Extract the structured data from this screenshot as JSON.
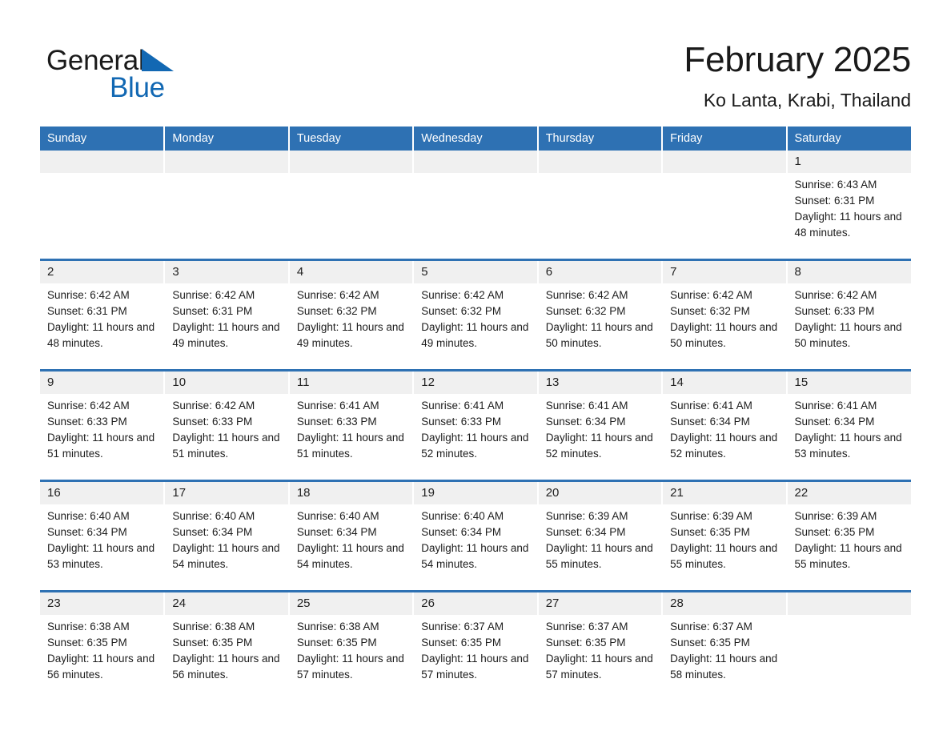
{
  "brand": {
    "name_part1": "General",
    "name_part2": "Blue",
    "triangle_color": "#1268b3"
  },
  "header": {
    "month_title": "February 2025",
    "location": "Ko Lanta, Krabi, Thailand"
  },
  "theme": {
    "header_blue": "#2e71b3",
    "daynum_band": "#f0f0f0",
    "text": "#1d1d1d"
  },
  "weekdays": [
    "Sunday",
    "Monday",
    "Tuesday",
    "Wednesday",
    "Thursday",
    "Friday",
    "Saturday"
  ],
  "labels": {
    "sunrise_prefix": "Sunrise:",
    "sunset_prefix": "Sunset:",
    "daylight_prefix": "Daylight:"
  },
  "weeks": [
    [
      {
        "day": "",
        "empty": true
      },
      {
        "day": "",
        "empty": true
      },
      {
        "day": "",
        "empty": true
      },
      {
        "day": "",
        "empty": true
      },
      {
        "day": "",
        "empty": true
      },
      {
        "day": "",
        "empty": true
      },
      {
        "day": "1",
        "sunrise": "Sunrise: 6:43 AM",
        "sunset": "Sunset: 6:31 PM",
        "daylight": "Daylight: 11 hours and 48 minutes."
      }
    ],
    [
      {
        "day": "2",
        "sunrise": "Sunrise: 6:42 AM",
        "sunset": "Sunset: 6:31 PM",
        "daylight": "Daylight: 11 hours and 48 minutes."
      },
      {
        "day": "3",
        "sunrise": "Sunrise: 6:42 AM",
        "sunset": "Sunset: 6:31 PM",
        "daylight": "Daylight: 11 hours and 49 minutes."
      },
      {
        "day": "4",
        "sunrise": "Sunrise: 6:42 AM",
        "sunset": "Sunset: 6:32 PM",
        "daylight": "Daylight: 11 hours and 49 minutes."
      },
      {
        "day": "5",
        "sunrise": "Sunrise: 6:42 AM",
        "sunset": "Sunset: 6:32 PM",
        "daylight": "Daylight: 11 hours and 49 minutes."
      },
      {
        "day": "6",
        "sunrise": "Sunrise: 6:42 AM",
        "sunset": "Sunset: 6:32 PM",
        "daylight": "Daylight: 11 hours and 50 minutes."
      },
      {
        "day": "7",
        "sunrise": "Sunrise: 6:42 AM",
        "sunset": "Sunset: 6:32 PM",
        "daylight": "Daylight: 11 hours and 50 minutes."
      },
      {
        "day": "8",
        "sunrise": "Sunrise: 6:42 AM",
        "sunset": "Sunset: 6:33 PM",
        "daylight": "Daylight: 11 hours and 50 minutes."
      }
    ],
    [
      {
        "day": "9",
        "sunrise": "Sunrise: 6:42 AM",
        "sunset": "Sunset: 6:33 PM",
        "daylight": "Daylight: 11 hours and 51 minutes."
      },
      {
        "day": "10",
        "sunrise": "Sunrise: 6:42 AM",
        "sunset": "Sunset: 6:33 PM",
        "daylight": "Daylight: 11 hours and 51 minutes."
      },
      {
        "day": "11",
        "sunrise": "Sunrise: 6:41 AM",
        "sunset": "Sunset: 6:33 PM",
        "daylight": "Daylight: 11 hours and 51 minutes."
      },
      {
        "day": "12",
        "sunrise": "Sunrise: 6:41 AM",
        "sunset": "Sunset: 6:33 PM",
        "daylight": "Daylight: 11 hours and 52 minutes."
      },
      {
        "day": "13",
        "sunrise": "Sunrise: 6:41 AM",
        "sunset": "Sunset: 6:34 PM",
        "daylight": "Daylight: 11 hours and 52 minutes."
      },
      {
        "day": "14",
        "sunrise": "Sunrise: 6:41 AM",
        "sunset": "Sunset: 6:34 PM",
        "daylight": "Daylight: 11 hours and 52 minutes."
      },
      {
        "day": "15",
        "sunrise": "Sunrise: 6:41 AM",
        "sunset": "Sunset: 6:34 PM",
        "daylight": "Daylight: 11 hours and 53 minutes."
      }
    ],
    [
      {
        "day": "16",
        "sunrise": "Sunrise: 6:40 AM",
        "sunset": "Sunset: 6:34 PM",
        "daylight": "Daylight: 11 hours and 53 minutes."
      },
      {
        "day": "17",
        "sunrise": "Sunrise: 6:40 AM",
        "sunset": "Sunset: 6:34 PM",
        "daylight": "Daylight: 11 hours and 54 minutes."
      },
      {
        "day": "18",
        "sunrise": "Sunrise: 6:40 AM",
        "sunset": "Sunset: 6:34 PM",
        "daylight": "Daylight: 11 hours and 54 minutes."
      },
      {
        "day": "19",
        "sunrise": "Sunrise: 6:40 AM",
        "sunset": "Sunset: 6:34 PM",
        "daylight": "Daylight: 11 hours and 54 minutes."
      },
      {
        "day": "20",
        "sunrise": "Sunrise: 6:39 AM",
        "sunset": "Sunset: 6:34 PM",
        "daylight": "Daylight: 11 hours and 55 minutes."
      },
      {
        "day": "21",
        "sunrise": "Sunrise: 6:39 AM",
        "sunset": "Sunset: 6:35 PM",
        "daylight": "Daylight: 11 hours and 55 minutes."
      },
      {
        "day": "22",
        "sunrise": "Sunrise: 6:39 AM",
        "sunset": "Sunset: 6:35 PM",
        "daylight": "Daylight: 11 hours and 55 minutes."
      }
    ],
    [
      {
        "day": "23",
        "sunrise": "Sunrise: 6:38 AM",
        "sunset": "Sunset: 6:35 PM",
        "daylight": "Daylight: 11 hours and 56 minutes."
      },
      {
        "day": "24",
        "sunrise": "Sunrise: 6:38 AM",
        "sunset": "Sunset: 6:35 PM",
        "daylight": "Daylight: 11 hours and 56 minutes."
      },
      {
        "day": "25",
        "sunrise": "Sunrise: 6:38 AM",
        "sunset": "Sunset: 6:35 PM",
        "daylight": "Daylight: 11 hours and 57 minutes."
      },
      {
        "day": "26",
        "sunrise": "Sunrise: 6:37 AM",
        "sunset": "Sunset: 6:35 PM",
        "daylight": "Daylight: 11 hours and 57 minutes."
      },
      {
        "day": "27",
        "sunrise": "Sunrise: 6:37 AM",
        "sunset": "Sunset: 6:35 PM",
        "daylight": "Daylight: 11 hours and 57 minutes."
      },
      {
        "day": "28",
        "sunrise": "Sunrise: 6:37 AM",
        "sunset": "Sunset: 6:35 PM",
        "daylight": "Daylight: 11 hours and 58 minutes."
      },
      {
        "day": "",
        "empty": true
      }
    ]
  ]
}
